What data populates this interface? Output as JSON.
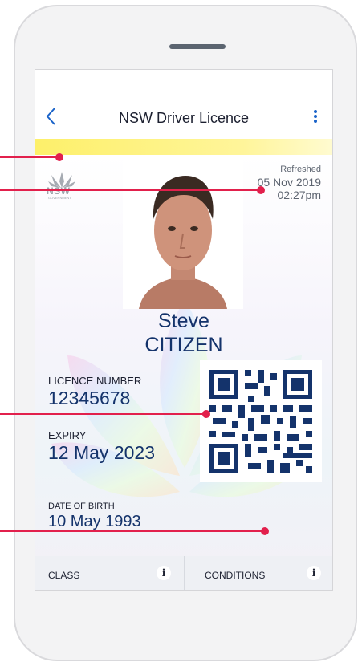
{
  "header": {
    "title": "NSW Driver Licence",
    "back_icon": "chevron-left-icon",
    "menu_icon": "more-vertical-icon"
  },
  "branding": {
    "logo_text": "NSW",
    "logo_subtext": "GOVERNMENT"
  },
  "refresh": {
    "label": "Refreshed",
    "date": "05 Nov 2019",
    "time": "02:27pm"
  },
  "holder": {
    "first_name": "Steve",
    "last_name": "CITIZEN"
  },
  "licence": {
    "number_label": "LICENCE NUMBER",
    "number": "12345678",
    "expiry_label": "EXPIRY",
    "expiry": "12 May 2023",
    "dob_label": "DATE OF BIRTH",
    "dob": "10 May 1993"
  },
  "footer": {
    "class_label": "CLASS",
    "conditions_label": "CONDITIONS",
    "info_glyph": "i"
  },
  "colors": {
    "accent": "#1a63c9",
    "navy": "#14336b",
    "pointer": "#e2204c",
    "band": "#fdf06a"
  }
}
